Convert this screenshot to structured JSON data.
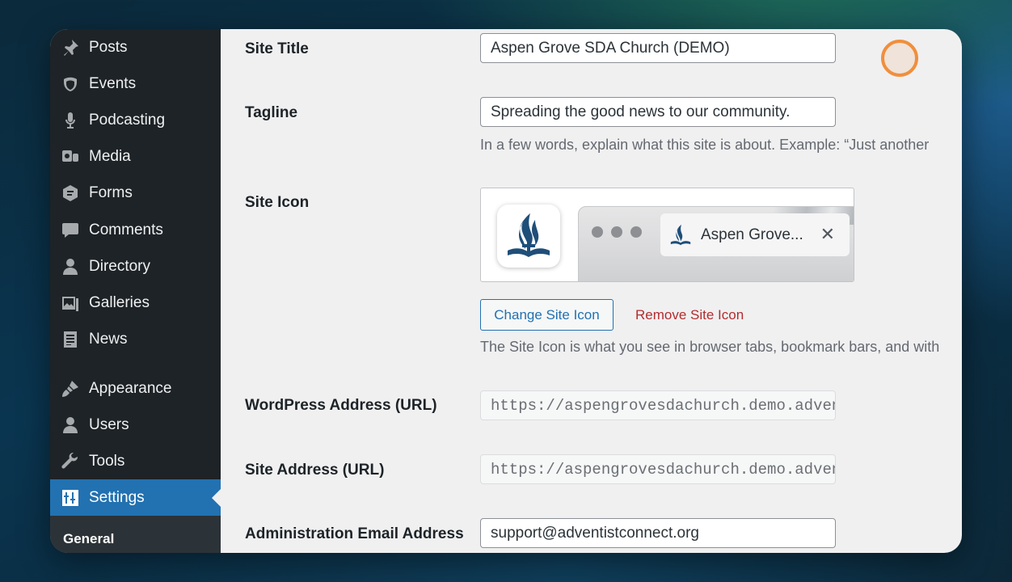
{
  "sidebar": {
    "items": [
      {
        "label": "Posts",
        "icon": "pin-icon"
      },
      {
        "label": "Events",
        "icon": "calendar-icon"
      },
      {
        "label": "Podcasting",
        "icon": "microphone-icon"
      },
      {
        "label": "Media",
        "icon": "media-icon"
      },
      {
        "label": "Forms",
        "icon": "forms-icon"
      },
      {
        "label": "Comments",
        "icon": "comment-icon"
      },
      {
        "label": "Directory",
        "icon": "user-icon"
      },
      {
        "label": "Galleries",
        "icon": "gallery-icon"
      },
      {
        "label": "News",
        "icon": "document-icon"
      },
      {
        "label": "Appearance",
        "icon": "brush-icon"
      },
      {
        "label": "Users",
        "icon": "users-icon"
      },
      {
        "label": "Tools",
        "icon": "wrench-icon"
      },
      {
        "label": "Settings",
        "icon": "settings-icon",
        "active": true
      }
    ],
    "submenu": {
      "current": "General"
    }
  },
  "form": {
    "site_title": {
      "label": "Site Title",
      "value": "Aspen Grove SDA Church (DEMO)"
    },
    "tagline": {
      "label": "Tagline",
      "value": "Spreading the good news to our community.",
      "description": "In a few words, explain what this site is about. Example: “Just another"
    },
    "site_icon": {
      "label": "Site Icon",
      "preview_tab_title": "Aspen Grove...",
      "preview_tab_close": "✕",
      "change_button": "Change Site Icon",
      "remove_link": "Remove Site Icon",
      "description": "The Site Icon is what you see in browser tabs, bookmark bars, and with"
    },
    "wordpress_address": {
      "label": "WordPress Address (URL)",
      "value": "https://aspengrovesdachurch.demo.adventi"
    },
    "site_address": {
      "label": "Site Address (URL)",
      "value": "https://aspengrovesdachurch.demo.adventi"
    },
    "admin_email": {
      "label": "Administration Email Address",
      "value": "support@adventistconnect.org"
    }
  },
  "colors": {
    "sidebar_bg": "#1d2327",
    "active_bg": "#2271b1",
    "remove_link": "#b32d2e",
    "cursor_ring": "#f08f3c"
  }
}
